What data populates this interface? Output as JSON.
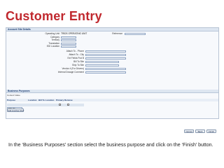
{
  "slide": {
    "title": "Customer Entry",
    "instruction": "In the ‘Business Purposes’ section select the business purpose and click on the ‘Finish’ button."
  },
  "account_site": {
    "header": "Account Site Details",
    "operating_unit_label": "Operating Unit",
    "operating_unit_value": "TRIDS OPERATING UNIT",
    "category_label": "Category",
    "territory_label": "Territory",
    "translation_label": "Translation",
    "eft_label": "EDI Location",
    "reference_label": "Reference",
    "right_fields": [
      "Attach To - Phone",
      "Attach To - City",
      "Ext Fields Pod B",
      "Bill To Site",
      "Ship To Site",
      "Vendor # (For Drivers)",
      "Internal Dosage Comment"
    ]
  },
  "business_purposes": {
    "header": "Business Purposes",
    "content_value_label": "Content Value",
    "columns": [
      "Purpose",
      "Location",
      "Bill To Location",
      "Primary",
      "Remove"
    ],
    "row_purpose": "Ship To",
    "add_button": "Add Another Row"
  },
  "footer_buttons": {
    "cancel": "Cancel",
    "back": "Back",
    "finish": "Finish"
  }
}
